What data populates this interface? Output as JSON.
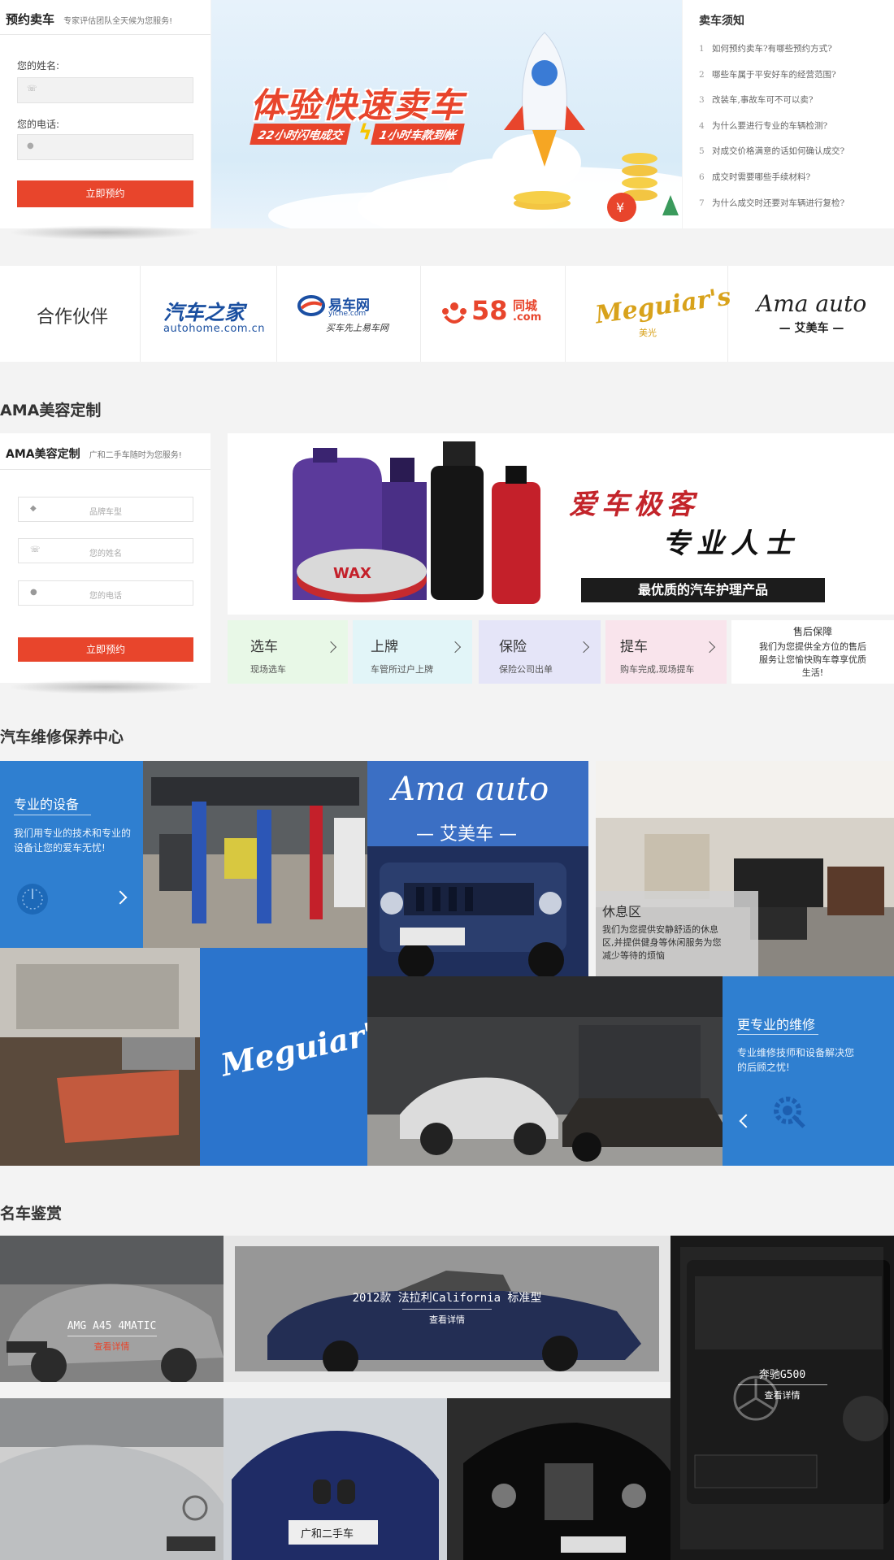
{
  "booking": {
    "title": "预约卖车",
    "subtitle": "专家评估团队全天候为您服务!",
    "name_label": "您的姓名:",
    "phone_label": "您的电话:",
    "submit_label": "立即预约"
  },
  "hero": {
    "headline": "体验快速卖车",
    "tag_part1": "22小时闪电成交",
    "tag_part2": "1小时车款到帐"
  },
  "notice": {
    "title": "卖车须知",
    "items": [
      {
        "num": "1",
        "text": "如何预约卖车?有哪些预约方式?"
      },
      {
        "num": "2",
        "text": "哪些车属于平安好车的经营范围?"
      },
      {
        "num": "3",
        "text": "改装车,事故车可不可以卖?"
      },
      {
        "num": "4",
        "text": "为什么要进行专业的车辆检测?"
      },
      {
        "num": "5",
        "text": "对成交价格满意的话如何确认成交?"
      },
      {
        "num": "6",
        "text": "成交时需要哪些手续材料?"
      },
      {
        "num": "7",
        "text": "为什么成交时还要对车辆进行复检?"
      }
    ]
  },
  "partners": {
    "label": "合作伙伴",
    "logos": [
      {
        "name": "汽车之家",
        "sub": "autohome.com.cn",
        "color": "#1a4fa0"
      },
      {
        "name": "易车网",
        "sub": "yiche.com",
        "slogan": "买车先上易车网",
        "color": "#1b4fa3"
      },
      {
        "name": "58.com",
        "prefix": "58",
        "city": "同城",
        "color": "#e8452c"
      },
      {
        "name": "Meguiar's",
        "sub": "美光",
        "color": "#d8a21b"
      },
      {
        "name": "Ama auto",
        "sub": "艾美车",
        "color": "#222222"
      }
    ]
  },
  "beauty": {
    "heading": "AMA美容定制",
    "form_title": "AMA美容定制",
    "form_subtitle": "广和二手车随时为您服务!",
    "placeholder_brand": "品牌车型",
    "placeholder_name": "您的姓名",
    "placeholder_phone": "您的电话",
    "submit_label": "立即预约",
    "banner_line1": "爱车极客",
    "banner_line2": "专业人士",
    "banner_bar": "最优质的汽车护理产品",
    "services": [
      {
        "title": "选车",
        "desc": "现场选车",
        "color": "#e8f8e7"
      },
      {
        "title": "上牌",
        "desc": "车管所过户上牌",
        "color": "#e2f5f8"
      },
      {
        "title": "保险",
        "desc": "保险公司出单",
        "color": "#e5e5f8"
      },
      {
        "title": "提车",
        "desc": "购车完成,现场提车",
        "color": "#f9e4ec"
      }
    ],
    "after_sale": {
      "title": "售后保障",
      "desc": "我们为您提供全方位的售后服务让您愉快购车尊享优质生活!"
    }
  },
  "maintenance": {
    "heading": "汽车维修保养中心",
    "equipment": {
      "title": "专业的设备",
      "desc": "我们用专业的技术和专业的设备让您的爱车无忧!"
    },
    "ama_logo": {
      "script": "Ama auto",
      "cn": "艾美车"
    },
    "lounge": {
      "title": "休息区",
      "desc": "我们为您提供安静舒适的休息区,并提供健身等休闲服务为您减少等待的烦恼"
    },
    "meguiars": "Meguiar's",
    "repair": {
      "title": "更专业的维修",
      "desc": "专业维修技师和设备解决您的后顾之忧!"
    }
  },
  "cars": {
    "heading": "名车鉴赏",
    "items": [
      {
        "title": "AMG A45 4MATIC",
        "link": "查看详情"
      },
      {
        "title": "2012款 法拉利California 标准型",
        "link": "查看详情"
      },
      {
        "title": "奔驰G500",
        "link": "查看详情"
      }
    ],
    "plate_text": "广和二手车"
  },
  "colors": {
    "accent_red": "#e8452c",
    "tile_blue": "#2f7fd0"
  }
}
